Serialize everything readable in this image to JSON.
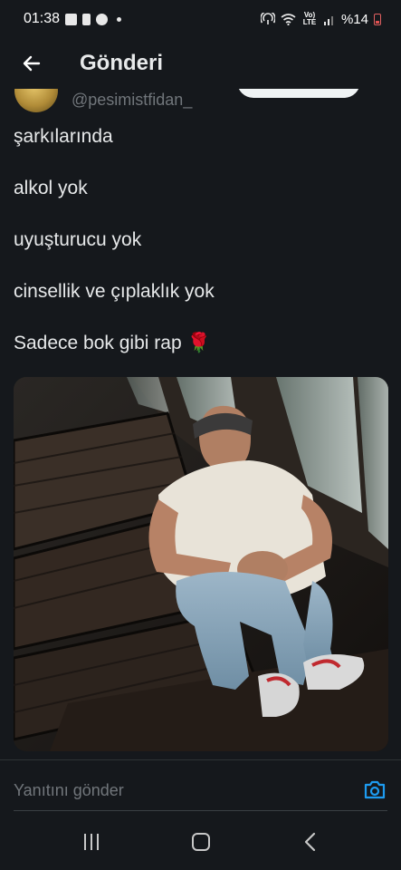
{
  "status_bar": {
    "time": "01:38",
    "network": "Vo) LTE",
    "battery": "%14",
    "battery_color": "#e05050"
  },
  "header": {
    "title": "Gönderi",
    "back_icon": "arrow-left-icon"
  },
  "author": {
    "handle": "@pesimistfidan_"
  },
  "tweet": {
    "lines": [
      "şarkılarında",
      "alkol yok",
      "uyuşturucu yok",
      "cinsellik ve çıplaklık yok",
      "Sadece bok gibi rap"
    ],
    "emoji": "🌹"
  },
  "reply": {
    "placeholder": "Yanıtını gönder",
    "camera_icon": "camera-icon",
    "accent": "#1d9bf0"
  },
  "nav": {
    "recents_icon": "recents-icon",
    "home_icon": "home-icon",
    "back_icon": "back-icon"
  }
}
